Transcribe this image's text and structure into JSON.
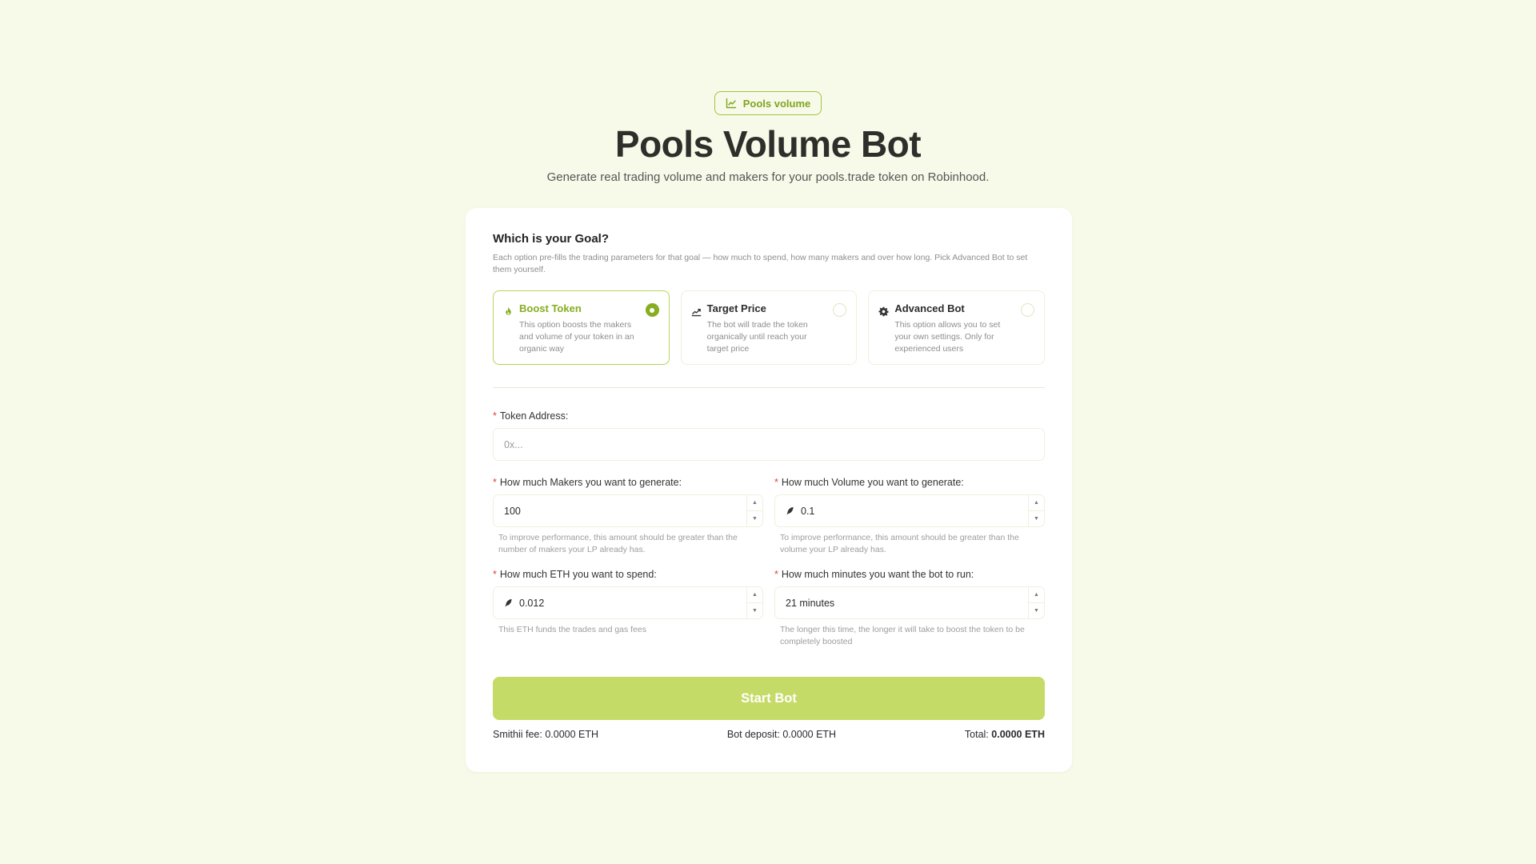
{
  "hero": {
    "badge_label": "Pools volume",
    "badge_icon": "chart-line-icon",
    "title": "Pools Volume Bot",
    "subtitle": "Generate real trading volume and makers for your pools.trade token on Robinhood."
  },
  "goal": {
    "title": "Which is your Goal?",
    "description": "Each option pre-fills the trading parameters for that goal — how much to spend, how many makers and over how long. Pick Advanced Bot to set them yourself.",
    "options": [
      {
        "title": "Boost Token",
        "description": "This option boosts the makers and volume of your token in an organic way",
        "icon": "flame-icon",
        "selected": true
      },
      {
        "title": "Target Price",
        "description": "The bot will trade the token organically until reach your target price",
        "icon": "chart-target-icon",
        "selected": false
      },
      {
        "title": "Advanced Bot",
        "description": "This option allows you to set your own settings. Only for experienced users",
        "icon": "gear-icon",
        "selected": false
      }
    ]
  },
  "form": {
    "required_mark": "*",
    "token_address": {
      "label": "Token Address:",
      "placeholder": "0x..."
    },
    "makers": {
      "label": "How much Makers you want to generate:",
      "value": "100",
      "help": "To improve performance, this amount should be greater than the number of makers your LP already has."
    },
    "volume": {
      "label": "How much Volume you want to generate:",
      "value": "0.1",
      "help": "To improve performance, this amount should be greater than the volume your LP already has."
    },
    "eth": {
      "label": "How much ETH you want to spend:",
      "value": "0.012",
      "help": "This ETH funds the trades and gas fees"
    },
    "minutes": {
      "label": "How much minutes you want the bot to run:",
      "value": "21 minutes",
      "help": "The longer this time, the longer it will take to boost the token to be completely boosted"
    }
  },
  "actions": {
    "start_label": "Start Bot"
  },
  "fees": {
    "smithii_label": "Smithii fee:",
    "smithii_value": "0.0000 ETH",
    "deposit_label": "Bot deposit:",
    "deposit_value": "0.0000 ETH",
    "total_label": "Total:",
    "total_value": "0.0000 ETH"
  },
  "colors": {
    "accent": "#87ad20",
    "button": "#c5db68",
    "background": "#f8fae9"
  }
}
